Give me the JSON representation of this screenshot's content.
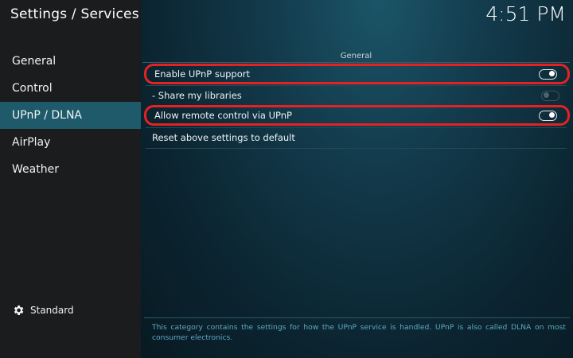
{
  "header": {
    "title": "Settings / Services",
    "clock": "4:51 PM"
  },
  "sidebar": {
    "items": [
      {
        "label": "General",
        "active": false
      },
      {
        "label": "Control",
        "active": false
      },
      {
        "label": "UPnP / DLNA",
        "active": true
      },
      {
        "label": "AirPlay",
        "active": false
      },
      {
        "label": "Weather",
        "active": false
      }
    ],
    "settings_level": {
      "label": "Standard",
      "icon": "gear-icon"
    }
  },
  "main": {
    "section_title": "General",
    "settings": [
      {
        "label": "Enable UPnP support",
        "toggle": true,
        "enabled": true
      },
      {
        "label": "- Share my libraries",
        "toggle": false,
        "enabled": false
      },
      {
        "label": "Allow remote control via UPnP",
        "toggle": true,
        "enabled": true
      },
      {
        "label": "Reset above settings to default"
      }
    ],
    "description": "This category contains the settings for how the UPnP service is handled. UPnP is also called DLNA on most consumer electronics."
  },
  "colors": {
    "accent_highlight": "#e52222",
    "active_nav": "#1f5a6a",
    "description_text": "#5fa8c2"
  }
}
